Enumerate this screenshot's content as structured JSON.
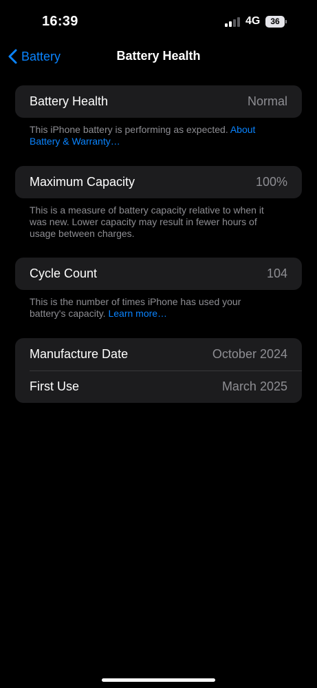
{
  "status_bar": {
    "time": "16:39",
    "network": "4G",
    "battery_level": "36",
    "signal_bars_filled": 2,
    "signal_bars_total": 4
  },
  "nav": {
    "back_label": "Battery",
    "title": "Battery Health"
  },
  "health": {
    "label": "Battery Health",
    "value": "Normal",
    "footer_text": "This iPhone battery is performing as expected. ",
    "footer_link": "About Battery & Warranty…"
  },
  "capacity": {
    "label": "Maximum Capacity",
    "value": "100%",
    "footer_text": "This is a measure of battery capacity relative to when it was new. Lower capacity may result in fewer hours of usage between charges."
  },
  "cycles": {
    "label": "Cycle Count",
    "value": "104",
    "footer_text": "This is the number of times iPhone has used your battery's capacity. ",
    "footer_link": "Learn more…"
  },
  "dates": {
    "manufacture_label": "Manufacture Date",
    "manufacture_value": "October 2024",
    "first_use_label": "First Use",
    "first_use_value": "March 2025"
  },
  "colors": {
    "background": "#000000",
    "card": "#1c1c1e",
    "accent": "#0a84ff",
    "secondary_text": "#8e8e93"
  }
}
